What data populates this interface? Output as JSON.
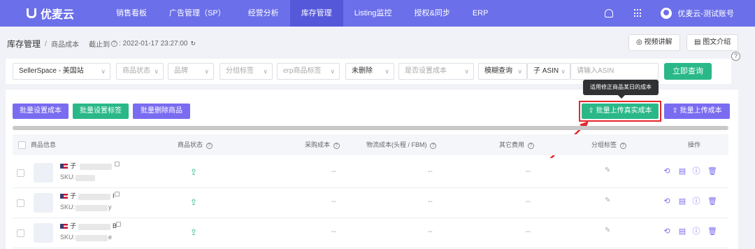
{
  "app": {
    "logo_text": "优麦云"
  },
  "nav": {
    "items": [
      "销售看板",
      "广告管理（SP）",
      "经营分析",
      "库存管理",
      "Listing监控",
      "授权&同步",
      "ERP"
    ],
    "active": "库存管理"
  },
  "account": {
    "name": "优麦云-测试账号"
  },
  "breadcrumb": {
    "main": "库存管理",
    "separator": "/",
    "sub": "商品成本",
    "until_label": "截止到",
    "until_time": ": 2022-01-17 23:27:00"
  },
  "top_buttons": {
    "video": "视频讲解",
    "doc": "图文介绍"
  },
  "filters": {
    "store": "SellerSpace - 美国站",
    "status": "商品状态",
    "brand": "品牌",
    "group": "分组标签",
    "erp_tag": "erp商品标签",
    "deleted": "未删除",
    "cost_set": "是否设置成本",
    "match": "模糊查询",
    "field": "子 ASIN",
    "search_placeholder": "请输入ASIN",
    "query_button": "立即查询"
  },
  "actions": {
    "batch_cost": "批量设置成本",
    "batch_tag": "批量设置标签",
    "batch_delete": "批量删除商品",
    "upload_real_cost": "批量上传真实成本",
    "upload_cost": "批量上传成本",
    "tooltip": "适用修正商品某日的成本"
  },
  "table": {
    "headers": {
      "product": "商品信息",
      "status": "商品状态",
      "purchase": "采购成本",
      "logistics": "物流成本(头程 / FBM)",
      "other": "其它费用",
      "group": "分组标签",
      "ops": "操作"
    },
    "rows": [
      {
        "asin_prefix": "子",
        "sku_prefix": "SKU:",
        "asin_tail": "",
        "sku_tail": "",
        "purchase": "--",
        "logistics": "--",
        "other": "--"
      },
      {
        "asin_prefix": "子",
        "sku_prefix": "SKU:",
        "asin_tail": "I",
        "sku_tail": "y",
        "purchase": "--",
        "logistics": "--",
        "other": "--"
      },
      {
        "asin_prefix": "子",
        "sku_prefix": "SKU:",
        "asin_tail": "B",
        "sku_tail": "e",
        "purchase": "--",
        "logistics": "--",
        "other": "--"
      }
    ]
  },
  "colors": {
    "nav": "#6b6fe9",
    "green": "#2ab889",
    "purple": "#7a6cf0",
    "annotation_red": "#e5262a"
  }
}
